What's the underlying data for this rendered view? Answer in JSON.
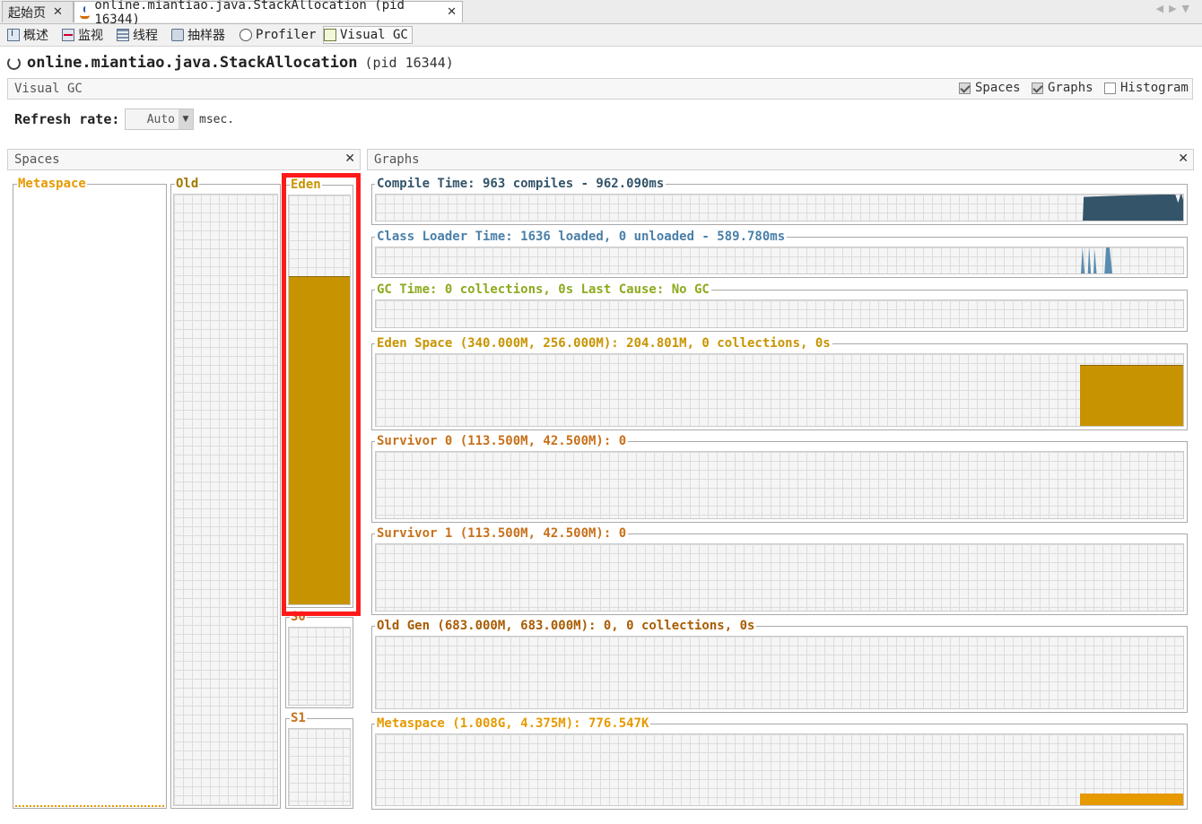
{
  "tabs": [
    {
      "label": "起始页",
      "active": false
    },
    {
      "label": "online.miantiao.java.StackAllocation (pid 16344)",
      "active": true
    }
  ],
  "views": [
    {
      "label": "概述",
      "icon": "info-icon"
    },
    {
      "label": "监视",
      "icon": "monitor-icon"
    },
    {
      "label": "线程",
      "icon": "threads-icon"
    },
    {
      "label": "抽样器",
      "icon": "sampler-icon"
    },
    {
      "label": "Profiler",
      "icon": "profiler-icon"
    },
    {
      "label": "Visual GC",
      "icon": "visualgc-icon"
    }
  ],
  "app": {
    "name": "online.miantiao.java.StackAllocation",
    "pid": "(pid 16344)"
  },
  "visual_gc": {
    "label": "Visual GC",
    "options": [
      {
        "label": "Spaces",
        "checked": true
      },
      {
        "label": "Graphs",
        "checked": true
      },
      {
        "label": "Histogram",
        "checked": false
      }
    ]
  },
  "refresh": {
    "label": "Refresh rate:",
    "value": "Auto",
    "unit": "msec."
  },
  "spaces_panel": {
    "title": "Spaces",
    "items": [
      {
        "label": "Metaspace",
        "fill": 0.0
      },
      {
        "label": "Old",
        "fill": 0.0
      },
      {
        "label": "Eden",
        "fill": 0.8
      },
      {
        "label": "S0",
        "fill": 0.0
      },
      {
        "label": "S1",
        "fill": 0.0
      }
    ]
  },
  "graphs_panel": {
    "title": "Graphs",
    "graphs": [
      {
        "label": "Compile Time: 963 compiles - 962.090ms"
      },
      {
        "label": "Class Loader Time: 1636 loaded, 0 unloaded - 589.780ms"
      },
      {
        "label": "GC Time: 0 collections, 0s Last Cause: No GC"
      },
      {
        "label": "Eden Space (340.000M, 256.000M): 204.801M, 0 collections, 0s"
      },
      {
        "label": "Survivor 0 (113.500M, 42.500M): 0"
      },
      {
        "label": "Survivor 1 (113.500M, 42.500M): 0"
      },
      {
        "label": "Old Gen (683.000M, 683.000M): 0, 0 collections, 0s"
      },
      {
        "label": "Metaspace (1.008G, 4.375M): 776.547K"
      }
    ]
  },
  "colors": {
    "compile": "#34546a",
    "classloader": "#5a8cb0",
    "gc": "#8caa1e",
    "eden": "#c89300",
    "survivor": "#c8701a",
    "oldgen": "#a85c00",
    "metaspace": "#e69a00",
    "highlight": "#ff1a1a"
  }
}
